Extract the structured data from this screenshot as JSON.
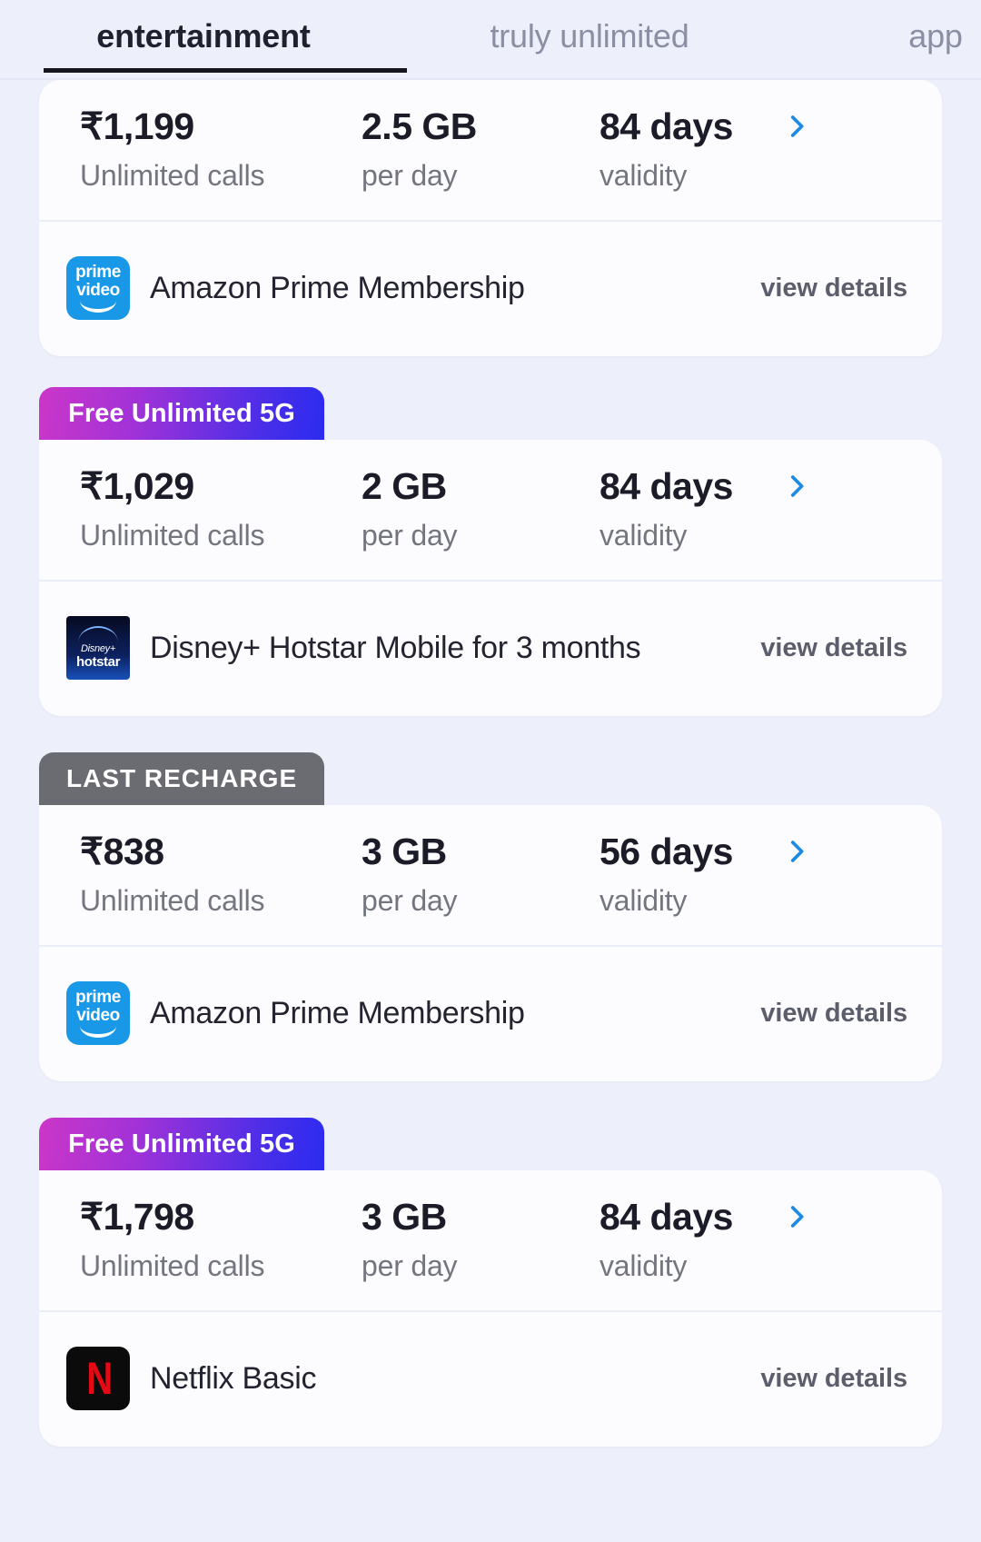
{
  "tabs": [
    {
      "label": "entertainment",
      "active": true
    },
    {
      "label": "truly unlimited",
      "active": false
    },
    {
      "label": "app",
      "active": false
    }
  ],
  "colors": {
    "page_background": "#edeffb",
    "card_background": "#fcfcfe",
    "chevron_blue": "#1a8ae5",
    "badge_5g_from": "#cc36c8",
    "badge_5g_to": "#2b2bf0",
    "badge_last_recharge": "#6b6b72",
    "primary_text": "#1b1c28",
    "secondary_text": "#74767f"
  },
  "labels": {
    "view_details": "view details",
    "chevron_icon": "chevron-right-icon"
  },
  "plans": [
    {
      "badge": null,
      "price": "₹1,199",
      "calls": "Unlimited calls",
      "data": "2.5 GB",
      "data_sub": "per day",
      "validity": "84 days",
      "validity_sub": "validity",
      "benefit_icon": "amazon-prime-video-icon",
      "benefit": "Amazon Prime Membership",
      "view_details": "view details"
    },
    {
      "badge": "Free Unlimited 5G",
      "badge_type": "5g",
      "price": "₹1,029",
      "calls": "Unlimited calls",
      "data": "2 GB",
      "data_sub": "per day",
      "validity": "84 days",
      "validity_sub": "validity",
      "benefit_icon": "disney-hotstar-icon",
      "benefit": "Disney+ Hotstar Mobile for 3 months",
      "view_details": "view details"
    },
    {
      "badge": "LAST RECHARGE",
      "badge_type": "last",
      "price": "₹838",
      "calls": "Unlimited calls",
      "data": "3 GB",
      "data_sub": "per day",
      "validity": "56 days",
      "validity_sub": "validity",
      "benefit_icon": "amazon-prime-video-icon",
      "benefit": "Amazon Prime Membership",
      "view_details": "view details"
    },
    {
      "badge": "Free Unlimited 5G",
      "badge_type": "5g",
      "price": "₹1,798",
      "calls": "Unlimited calls",
      "data": "3 GB",
      "data_sub": "per day",
      "validity": "84 days",
      "validity_sub": "validity",
      "benefit_icon": "netflix-icon",
      "benefit": "Netflix Basic",
      "view_details": "view details"
    }
  ]
}
